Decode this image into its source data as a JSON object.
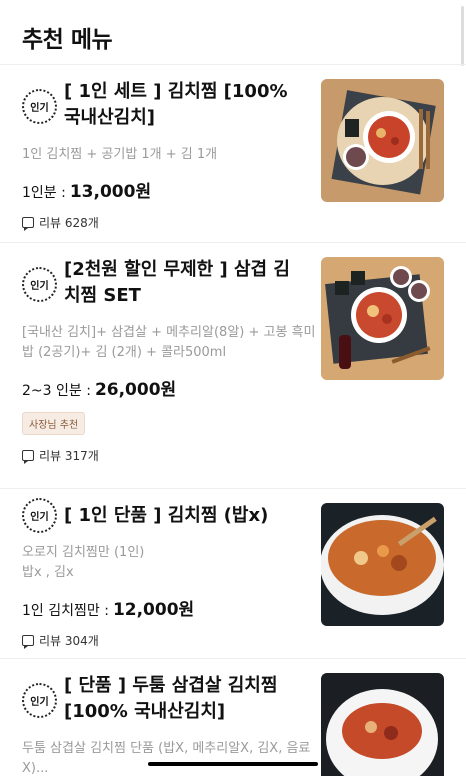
{
  "header": {
    "title": "추천 메뉴"
  },
  "items": [
    {
      "badge": "인기",
      "title": "[ 1인 세트 ]  김치찜  [100% 국내산김치]",
      "description": "1인 김치찜 + 공기밥 1개 + 김 1개",
      "price_label": "1인분 :",
      "price": "13,000원",
      "reviews": "리뷰 628개"
    },
    {
      "badge": "인기",
      "title": "[2천원 할인 무제한 ] 삼겹 김치찜 SET",
      "description": "[국내산 김치]+ 삼겹살 + 메추리알(8알) + 고봉 흑미밥 (2공기)+ 김 (2개) + 콜라500ml",
      "price_label": "2~3 인분 :",
      "price": "26,000원",
      "owner_badge": "사장님 추천",
      "reviews": "리뷰 317개"
    },
    {
      "badge": "인기",
      "title": "[ 1인 단품 ]  김치찜 (밥x)",
      "description": "오로지 김치찜만 (1인)\n밥x , 김x",
      "price_label": "1인 김치찜만 :",
      "price": "12,000원",
      "reviews": "리뷰 304개"
    },
    {
      "badge": "인기",
      "title": "[ 단품 ] 두툼 삼겹살 김치찜 [100% 국내산김치]",
      "description": "두툼 삼겹살 김치찜 단품  (밥X, 메추리알X,  김X, 음료X)..."
    }
  ]
}
